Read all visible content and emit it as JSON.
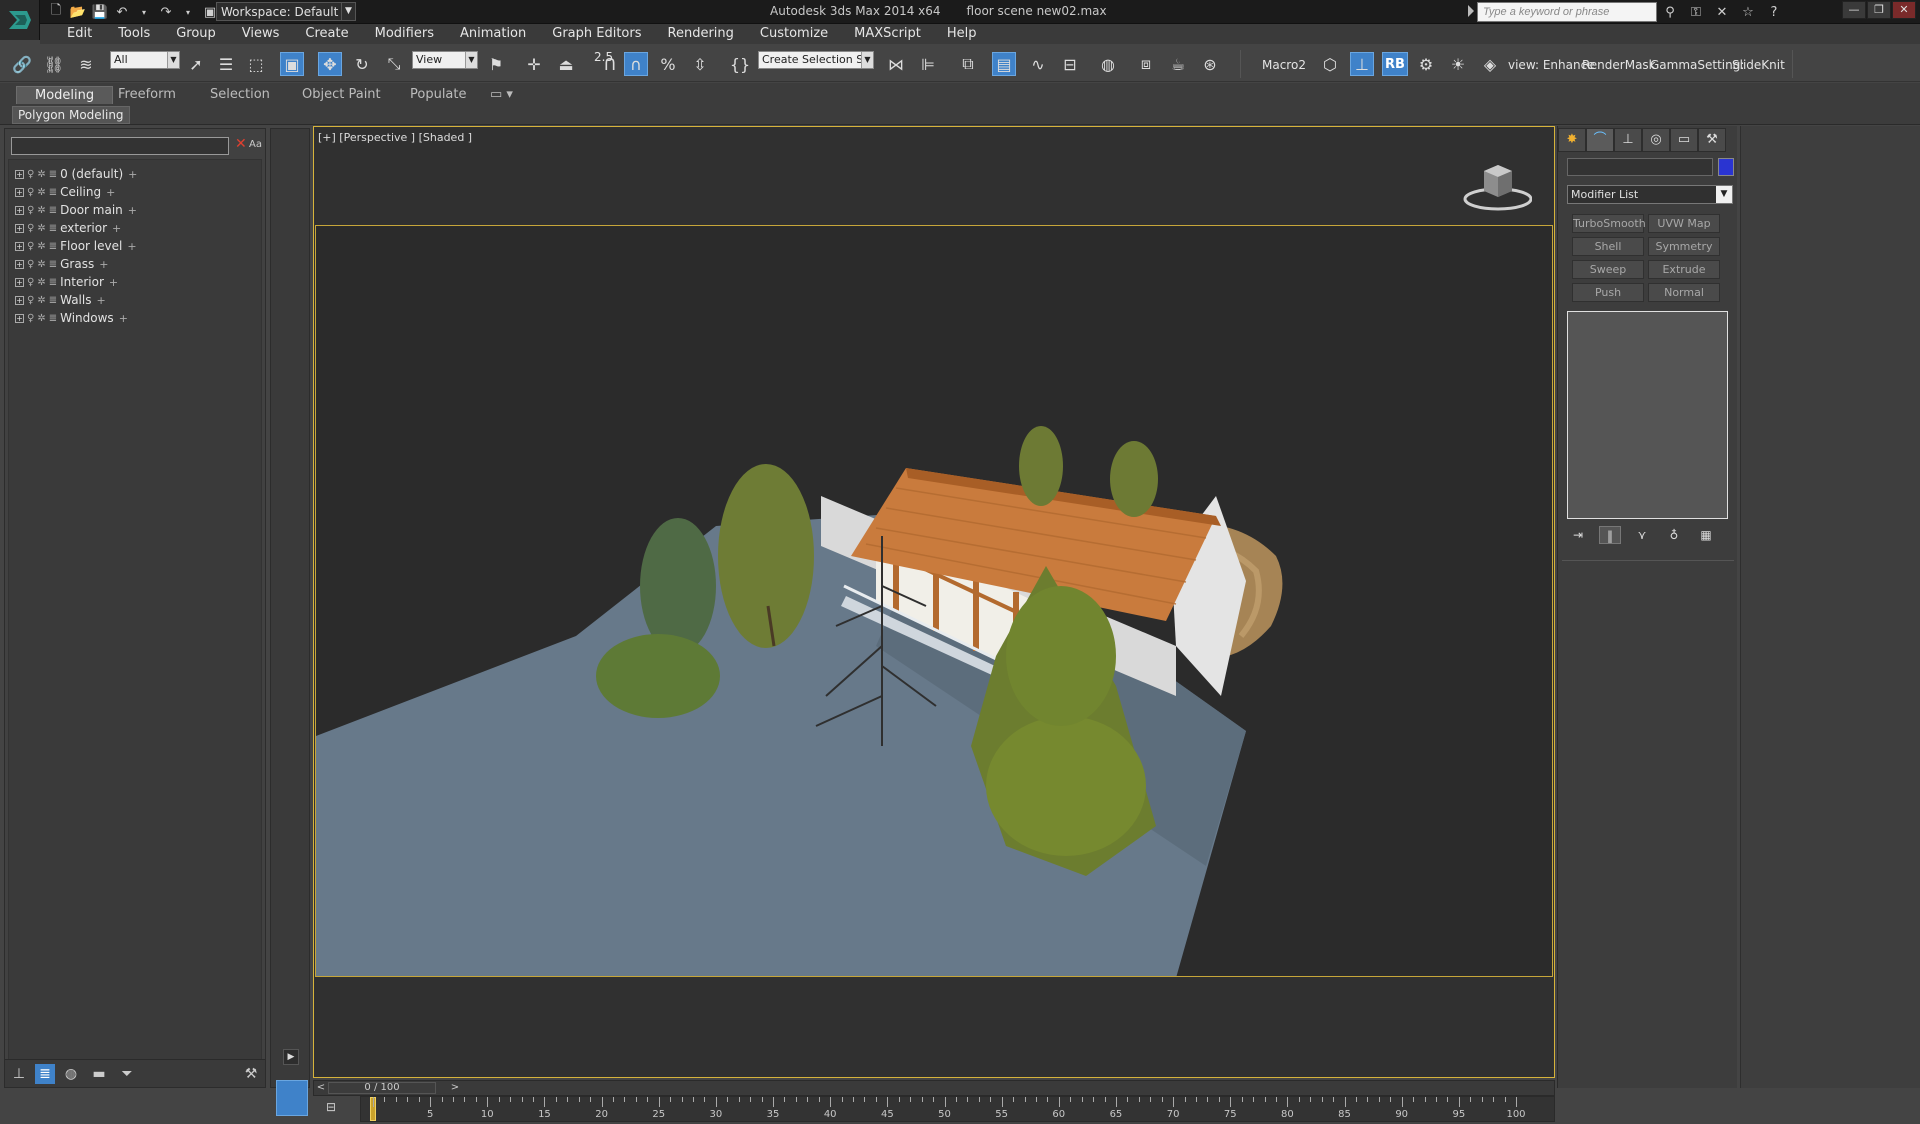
{
  "title_bar": {
    "workspace": "Workspace: Default",
    "app_name": "Autodesk 3ds Max  2014 x64",
    "file_name": "floor scene new02.max",
    "search_placeholder": "Type a keyword or phrase"
  },
  "menu": [
    "Edit",
    "Tools",
    "Group",
    "Views",
    "Create",
    "Modifiers",
    "Animation",
    "Graph Editors",
    "Rendering",
    "Customize",
    "MAXScript",
    "Help"
  ],
  "toolbar": {
    "selection_filter": "All",
    "ref_coord": "View",
    "snap_value": "2.5",
    "named_selection": "Create Selection Se",
    "macro_label": "Macro2",
    "rb_label": "RB",
    "scripts": [
      "view: Enhance",
      "RenderMask",
      "GammaSetting:",
      "SlideKnit"
    ]
  },
  "ribbon": {
    "tabs": [
      "Modeling",
      "Freeform",
      "Selection",
      "Object Paint",
      "Populate"
    ],
    "active_tab": "Modeling",
    "sub_button": "Polygon Modeling"
  },
  "scene_explorer": {
    "search_value": "",
    "clear_icon": "close-icon",
    "case_label": "Aa",
    "layers": [
      "0 (default)",
      "Ceiling",
      "Door main",
      "exterior",
      "Floor level",
      "Grass",
      "Interior",
      "Walls",
      "Windows"
    ]
  },
  "viewport": {
    "label": "[+] [Perspective ] [Shaded ]",
    "frame_color": "#d6b33b"
  },
  "command_panel": {
    "object_name": "",
    "object_color": "#2a34d1",
    "modifier_list": "Modifier List",
    "modifier_buttons": [
      "TurboSmooth",
      "UVW Map",
      "Shell",
      "Symmetry",
      "Sweep",
      "Extrude",
      "Push",
      "Normal"
    ]
  },
  "timeline": {
    "frame_display": "0 / 100",
    "prev_label": "<",
    "next_label": ">",
    "ticks": [
      5,
      10,
      15,
      20,
      25,
      30,
      35,
      40,
      45,
      50,
      55,
      60,
      65,
      70,
      75,
      80,
      85,
      90,
      95,
      100
    ],
    "max_frame": 100,
    "current_frame": 0
  },
  "colors": {
    "accent": "#3f82c9",
    "viewport_frame": "#d6b33b"
  }
}
